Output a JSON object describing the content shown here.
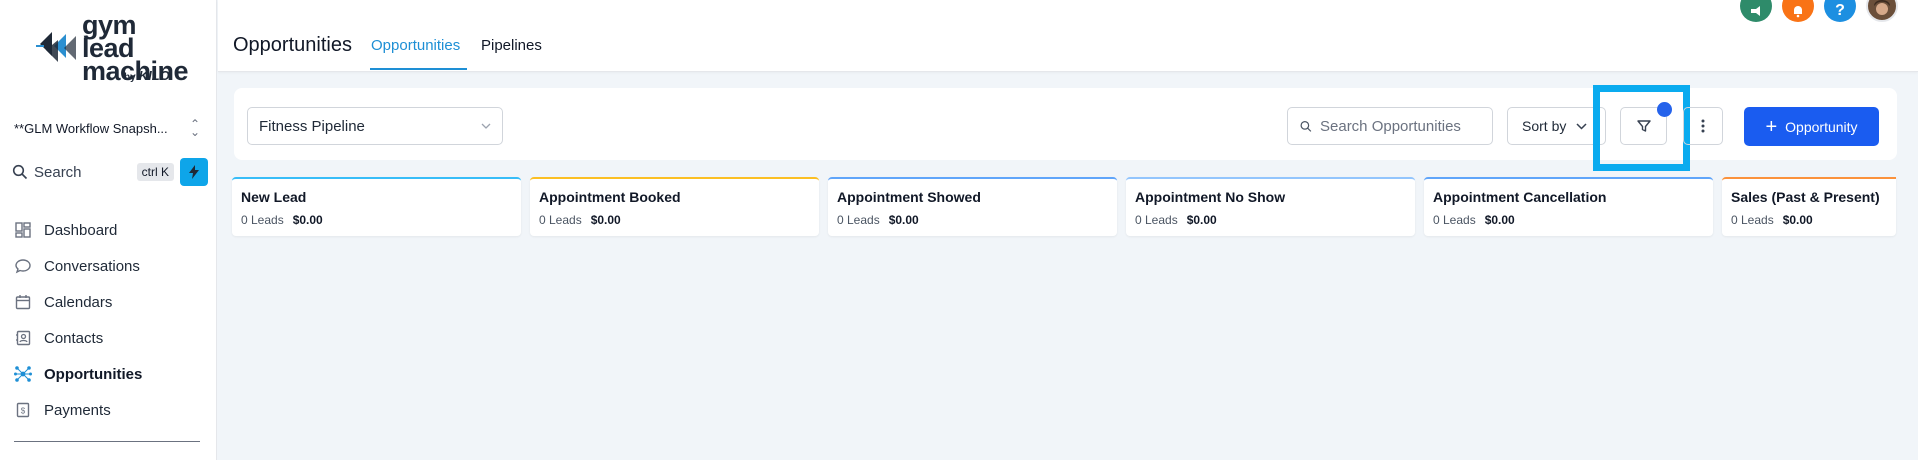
{
  "brand": {
    "line1": "gym lead",
    "line2": "machine",
    "by": "by",
    "company": "KILO"
  },
  "sidebar": {
    "location": "**GLM Workflow Snapsh...",
    "search_label": "Search",
    "shortcut": "ctrl K",
    "items": [
      {
        "label": "Dashboard",
        "icon": "dashboard-icon"
      },
      {
        "label": "Conversations",
        "icon": "chat-bubble-icon"
      },
      {
        "label": "Calendars",
        "icon": "calendar-icon"
      },
      {
        "label": "Contacts",
        "icon": "contact-book-icon"
      },
      {
        "label": "Opportunities",
        "icon": "opportunities-icon",
        "active": true
      },
      {
        "label": "Payments",
        "icon": "payments-icon"
      }
    ]
  },
  "header": {
    "title": "Opportunities",
    "tabs": [
      {
        "label": "Opportunities",
        "active": true
      },
      {
        "label": "Pipelines",
        "active": false
      }
    ],
    "icons": [
      {
        "name": "megaphone-icon",
        "color": "#2e8b6a"
      },
      {
        "name": "bell-icon",
        "color": "#f97316"
      },
      {
        "name": "help-icon",
        "glyph": "?",
        "color": "#1d8fe1"
      },
      {
        "name": "avatar",
        "color": "#6b4f3a"
      }
    ]
  },
  "toolbar": {
    "pipeline": "Fitness Pipeline",
    "search_placeholder": "Search Opportunities",
    "sort_label": "Sort by",
    "add_label": "Opportunity"
  },
  "stages": [
    {
      "name": "New Lead",
      "leads": "0 Leads",
      "amount": "$0.00",
      "color": "#38bdf8"
    },
    {
      "name": "Appointment Booked",
      "leads": "0 Leads",
      "amount": "$0.00",
      "color": "#fbbf24"
    },
    {
      "name": "Appointment Showed",
      "leads": "0 Leads",
      "amount": "$0.00",
      "color": "#60a5fa"
    },
    {
      "name": "Appointment No Show",
      "leads": "0 Leads",
      "amount": "$0.00",
      "color": "#93c5fd"
    },
    {
      "name": "Appointment Cancellation",
      "leads": "0 Leads",
      "amount": "$0.00",
      "color": "#60a5fa"
    },
    {
      "name": "Sales (Past & Present)",
      "leads": "0 Leads",
      "amount": "$0.00",
      "color": "#fb923c"
    }
  ],
  "colors": {
    "accent": "#1e8fd5",
    "primary_button": "#1a5cf0",
    "highlight": "#0aabef",
    "filter_dot": "#2563eb",
    "bolt": "#0ea5e9"
  }
}
